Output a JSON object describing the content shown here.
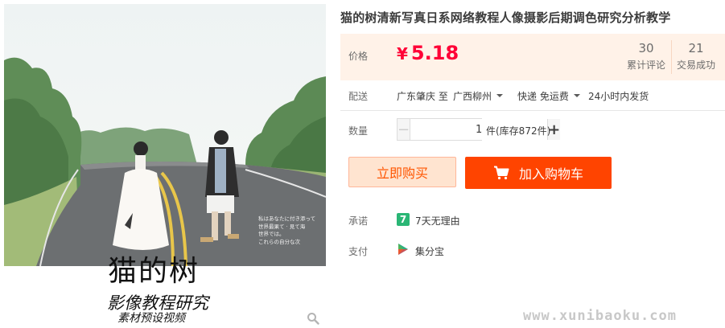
{
  "product": {
    "title": "猫的树清新写真日系网络教程人像摄影后期调色研究分析教学"
  },
  "image": {
    "brand_title": "猫的树",
    "brand_subtitle": "影像教程研究",
    "brand_subtitle2": "素材预设视频",
    "caption_text": "私はあなたに付き添って\n世界最果て · 見て海\n世界では。\nこれらの自分な次",
    "zoom_icon": "search-icon"
  },
  "price": {
    "label": "价格",
    "currency": "¥",
    "value": "5.18",
    "color": "#ff0036"
  },
  "stats": {
    "reviews_count": "30",
    "reviews_label": "累计评论",
    "sales_count": "21",
    "sales_label": "交易成功"
  },
  "shipping": {
    "label": "配送",
    "from": "广东肇庆 至",
    "to": "广西柳州",
    "method": "快递 免运费",
    "dispatch": "24小时内发货"
  },
  "quantity": {
    "label": "数量",
    "minus": "−",
    "plus": "+",
    "value": "1",
    "stock": "件(库存872件)"
  },
  "actions": {
    "buy_now": "立即购买",
    "add_to_cart": "加入购物车",
    "cart_icon": "shopping-cart-icon",
    "accent": "#ff4400"
  },
  "promise": {
    "label": "承诺",
    "badge": "7",
    "text": "7天无理由"
  },
  "payment": {
    "label": "支付",
    "icon": "jifenbao-icon",
    "text": "集分宝"
  },
  "watermark": {
    "text": "www.xunibaoku.com"
  }
}
